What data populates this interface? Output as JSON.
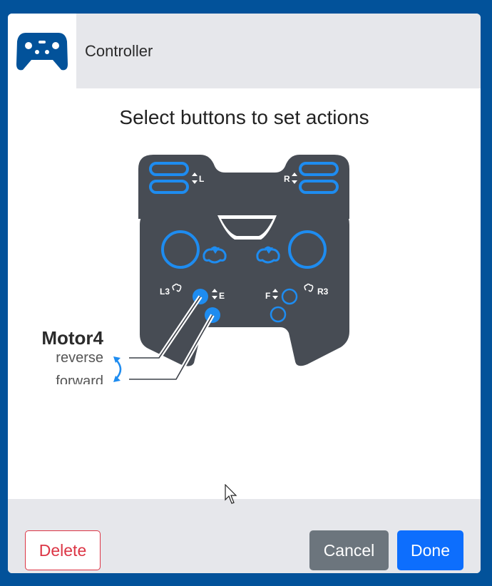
{
  "header": {
    "title": "Controller",
    "icon": "gamepad-icon"
  },
  "main": {
    "title": "Select buttons to set actions",
    "controller_labels": {
      "left_shoulder": "L",
      "right_shoulder": "R",
      "l3": "L3",
      "r3": "R3",
      "e": "E",
      "f": "F"
    },
    "motor": {
      "name": "Motor4",
      "reverse_label": "reverse",
      "forward_label": "forward"
    }
  },
  "footer": {
    "delete_label": "Delete",
    "cancel_label": "Cancel",
    "done_label": "Done"
  },
  "colors": {
    "frame": "#02529a",
    "controller_body": "#474c54",
    "accent_blue": "#1e8cf0",
    "delete": "#dc3545",
    "cancel": "#6c757d",
    "done": "#0d6efd"
  }
}
